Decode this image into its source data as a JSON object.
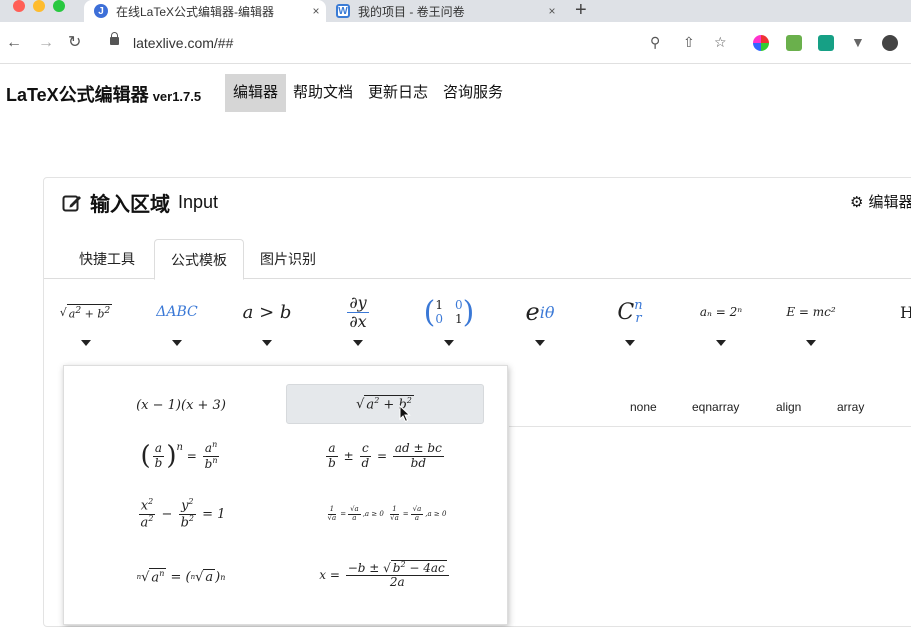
{
  "browser": {
    "tabs": [
      {
        "title": "在线LaTeX公式编辑器-编辑器",
        "favicon": "J"
      },
      {
        "title": "我的项目 - 卷王问卷",
        "favicon": "W"
      }
    ],
    "url": "latexlive.com/##",
    "new_tab": "+",
    "close_glyph": "×"
  },
  "app": {
    "brand": "LaTeX公式编辑器",
    "version": "ver1.7.5",
    "menu": [
      "编辑器",
      "帮助文档",
      "更新日志",
      "咨询服务"
    ]
  },
  "panel": {
    "title": "输入区域",
    "title_en": "Input",
    "settings_label": "编辑器",
    "tabs": [
      "快捷工具",
      "公式模板",
      "图片识别"
    ]
  },
  "toolbar": {
    "tools": [
      {
        "name": "sqrt-template"
      },
      {
        "name": "triangle-template",
        "label": "ΔABC"
      },
      {
        "name": "relation-template",
        "label": "a > b"
      },
      {
        "name": "derivative-template",
        "num": "∂y",
        "den": "∂x"
      },
      {
        "name": "matrix-template"
      },
      {
        "name": "exponent-template",
        "base": "e",
        "sup": "iθ"
      },
      {
        "name": "combination-template",
        "base": "C",
        "sup": "n",
        "sub": "r"
      },
      {
        "name": "sequence-template",
        "label": "aₙ = 2ⁿ"
      },
      {
        "name": "physics-template",
        "label": "E = mc²"
      },
      {
        "name": "more-template",
        "label": "H"
      }
    ]
  },
  "environments": [
    "none",
    "eqnarray",
    "align",
    "array"
  ],
  "dropdown": {
    "items": [
      "(x − 1)(x + 3)",
      "√(a² + b²)",
      "(a/b)ⁿ = aⁿ/bⁿ",
      "a/b ± c/d = (ad ± bc)/bd",
      "x²/a² − y²/b² = 1",
      "1/√a = √a/a, a ≥ 0",
      "ⁿ√(aⁿ) = (ⁿ√a)ⁿ",
      "x = (−b ± √(b² − 4ac))/2a"
    ]
  }
}
